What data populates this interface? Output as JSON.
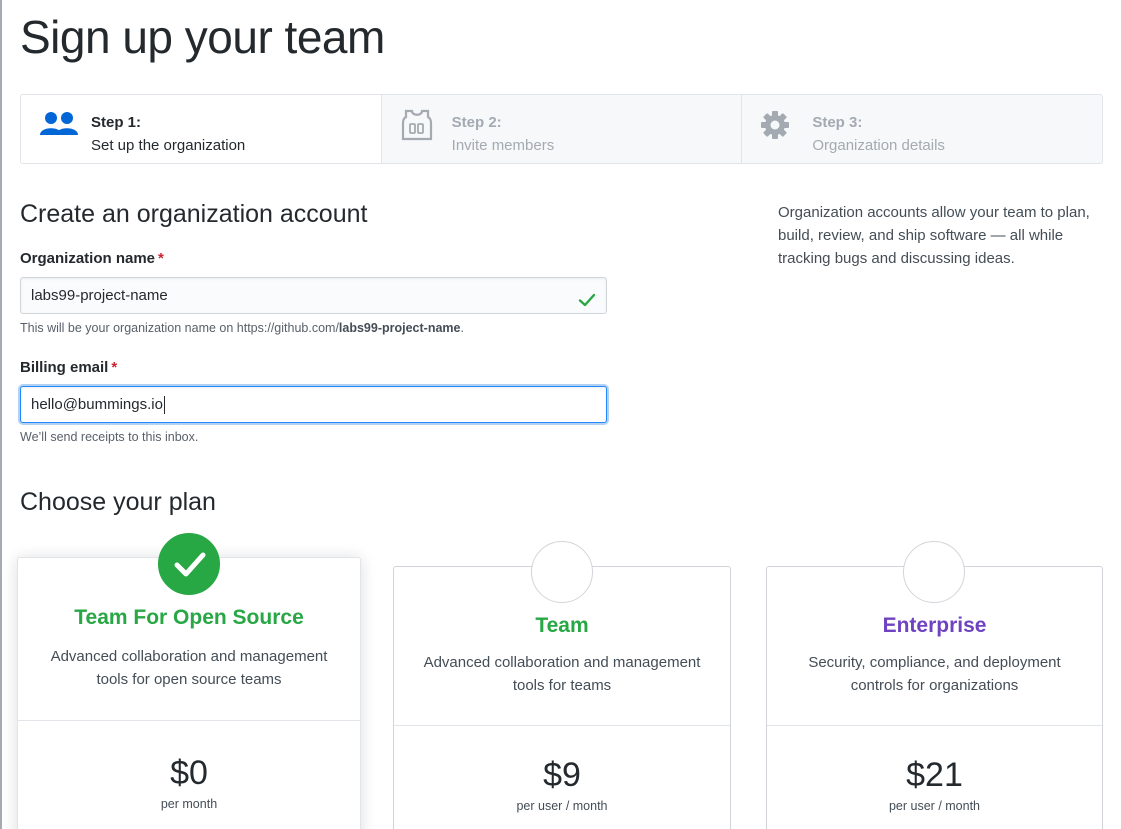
{
  "page": {
    "title": "Sign up your team"
  },
  "steps": [
    {
      "number": "Step 1:",
      "label": "Set up the organization",
      "icon": "people-icon",
      "active": true
    },
    {
      "number": "Step 2:",
      "label": "Invite members",
      "icon": "jersey-icon",
      "active": false
    },
    {
      "number": "Step 3:",
      "label": "Organization details",
      "icon": "gear-icon",
      "active": false
    }
  ],
  "account": {
    "heading": "Create an organization account",
    "sidebar_note": "Organization accounts allow your team to plan, build, review, and ship software — all while tracking bugs and discussing ideas.",
    "org_name": {
      "label": "Organization name",
      "required_mark": "*",
      "value": "labs99-project-name",
      "hint_prefix": "This will be your organization name on https://github.com/",
      "hint_bold": "labs99-project-name",
      "hint_suffix": "."
    },
    "billing_email": {
      "label": "Billing email",
      "required_mark": "*",
      "value": "hello@bummings.io",
      "hint": "We’ll send receipts to this inbox."
    }
  },
  "plans": {
    "heading": "Choose your plan",
    "items": [
      {
        "name": "Team For Open Source",
        "description": "Advanced collaboration and management tools for open source teams",
        "price": "$0",
        "unit": "per month",
        "selected": true,
        "color": "#28a745"
      },
      {
        "name": "Team",
        "description": "Advanced collaboration and management tools for teams",
        "price": "$9",
        "unit": "per user / month",
        "selected": false,
        "color": "#28a745"
      },
      {
        "name": "Enterprise",
        "description": "Security, compliance, and deployment controls for organizations",
        "price": "$21",
        "unit": "per user / month",
        "selected": false,
        "color": "#6f42c1"
      }
    ]
  },
  "colors": {
    "success": "#28a745",
    "enterprise": "#6f42c1",
    "link_blue": "#0366d6",
    "required": "#cb2431"
  }
}
